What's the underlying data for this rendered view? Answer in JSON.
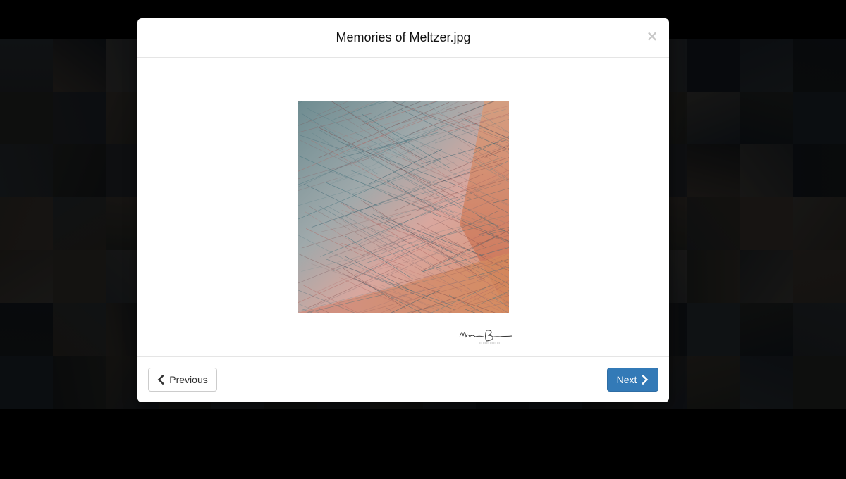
{
  "modal": {
    "title": "Memories of Meltzer.jpg",
    "close_label": "×",
    "image_name": "abstract-photo",
    "signature_icon": "photographer-signature-logo"
  },
  "footer": {
    "previous_label": "Previous",
    "next_label": "Next",
    "previous_icon": "chevron-left-icon",
    "next_icon": "chevron-right-icon"
  },
  "colors": {
    "primary": "#337ab7",
    "backdrop": "#000000"
  }
}
